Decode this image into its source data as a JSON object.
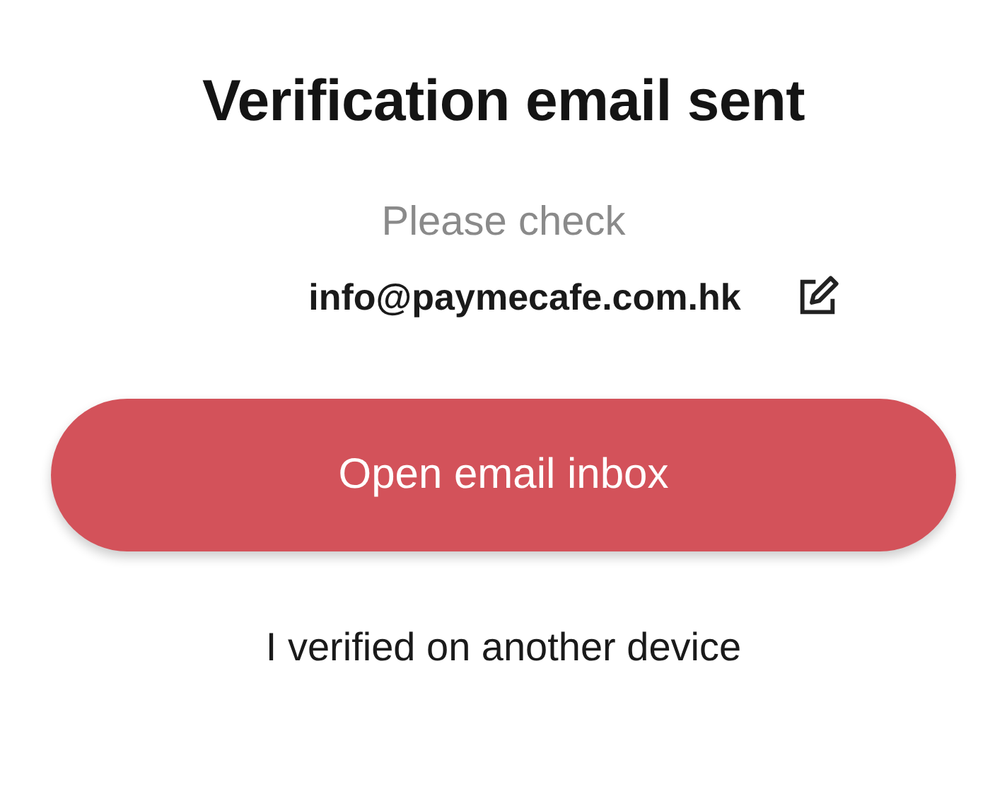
{
  "title": "Verification email sent",
  "prompt": "Please check",
  "email": "info@paymecafe.com.hk",
  "primary_button": "Open email inbox",
  "secondary_link": "I verified on another device"
}
